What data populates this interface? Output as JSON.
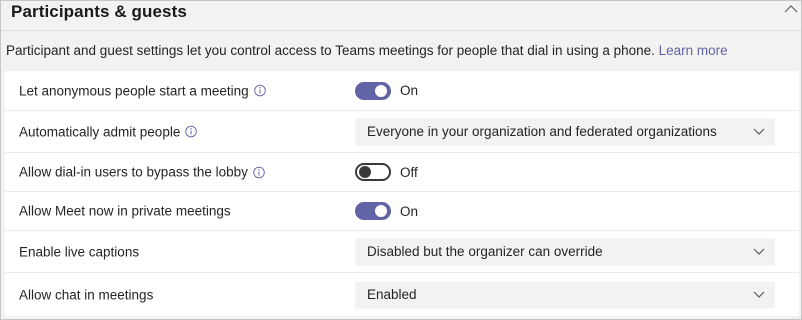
{
  "section": {
    "title": "Participants & guests"
  },
  "description": {
    "text": "Participant and guest settings let you control access to Teams meetings for people that dial in using a phone.",
    "link_label": "Learn more"
  },
  "colors": {
    "accent": "#6264a7",
    "toggle_off_border": "#3b3a39",
    "dropdown_bg": "#f3f2f1"
  },
  "settings": [
    {
      "label": "Let anonymous people start a meeting",
      "info_icon": "info-icon",
      "control": "toggle",
      "state": "On"
    },
    {
      "label": "Automatically admit people",
      "info_icon": "info-icon",
      "control": "dropdown",
      "value": "Everyone in your organization and federated organizations"
    },
    {
      "label": "Allow dial-in users to bypass the lobby",
      "info_icon": "info-icon",
      "control": "toggle",
      "state": "Off"
    },
    {
      "label": "Allow Meet now in private meetings",
      "control": "toggle",
      "state": "On"
    },
    {
      "label": "Enable live captions",
      "control": "dropdown",
      "value": "Disabled but the organizer can override"
    },
    {
      "label": "Allow chat in meetings",
      "control": "dropdown",
      "value": "Enabled"
    }
  ]
}
